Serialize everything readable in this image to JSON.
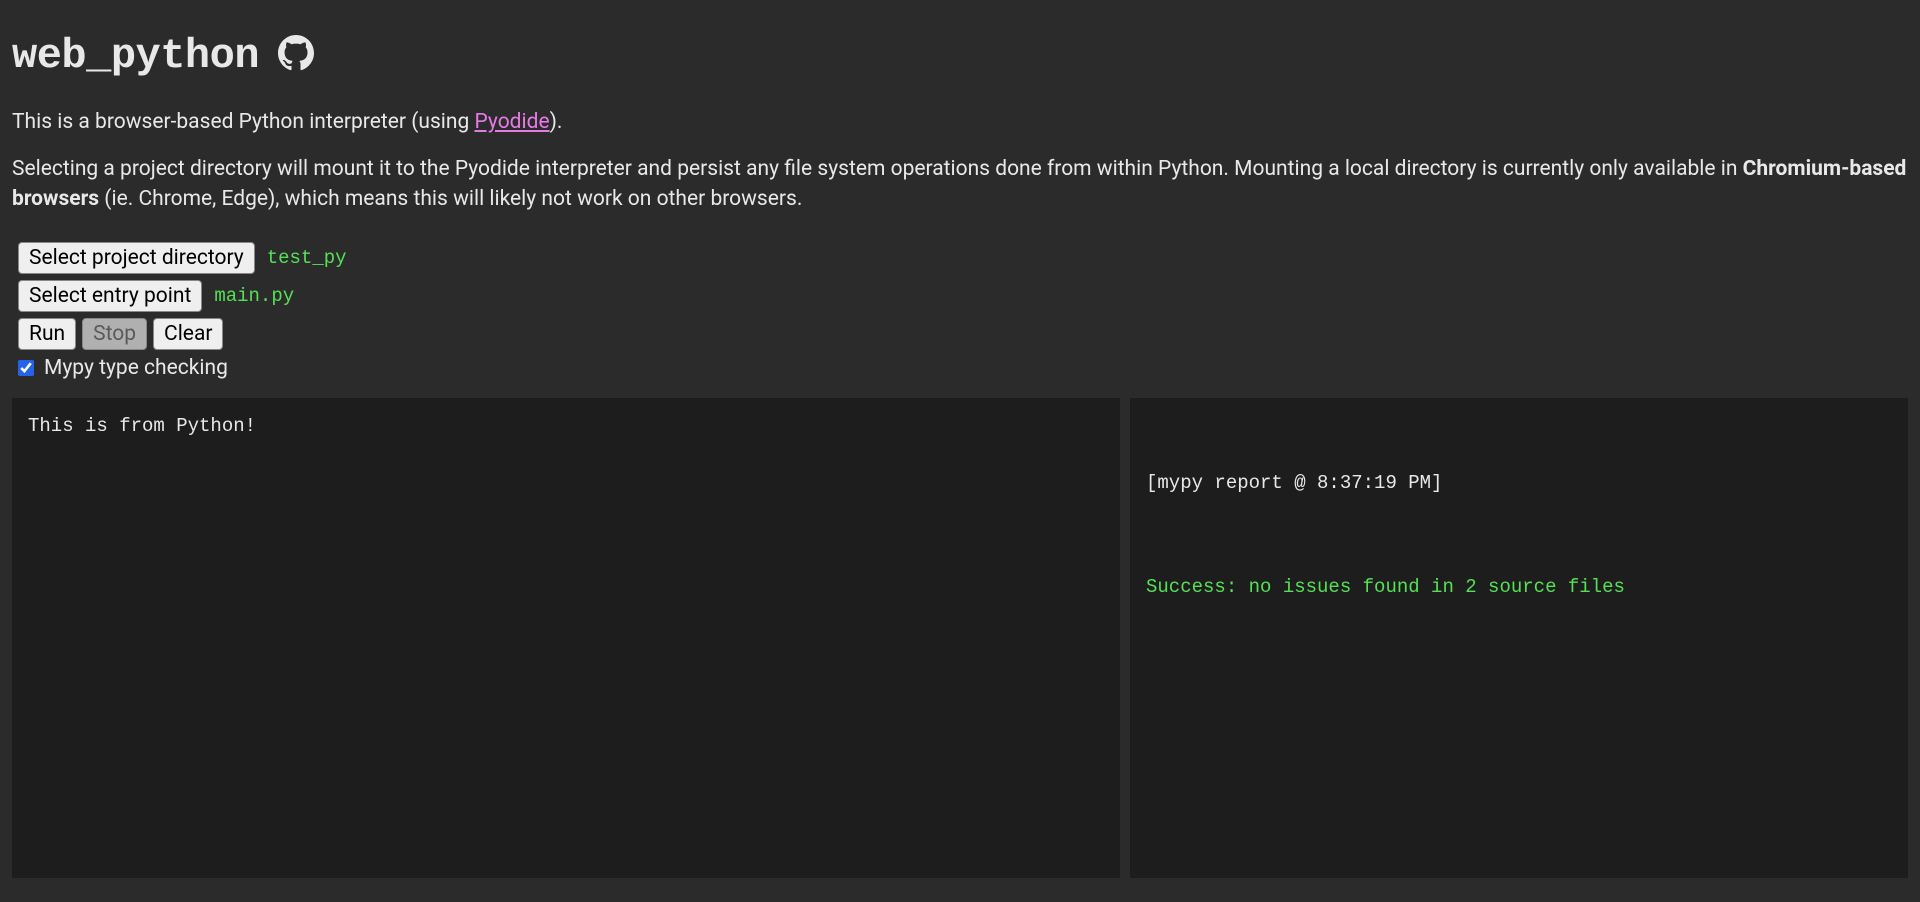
{
  "header": {
    "title": "web_python"
  },
  "intro": {
    "line1_prefix": "This is a browser-based Python interpreter (using ",
    "pyodide_link": "Pyodide",
    "line1_suffix": ").",
    "line2_prefix": "Selecting a project directory will mount it to the Pyodide interpreter and persist any file system operations done from within Python. Mounting a local directory is currently only available in ",
    "line2_strong": "Chromium-based browsers",
    "line2_suffix": " (ie. Chrome, Edge), which means this will likely not work on other browsers."
  },
  "controls": {
    "select_directory_label": "Select project directory",
    "selected_directory": "test_py",
    "select_entry_label": "Select entry point",
    "selected_entry": "main.py",
    "run_label": "Run",
    "stop_label": "Stop",
    "clear_label": "Clear",
    "mypy_checkbox_label": "Mypy type checking",
    "mypy_checked": true
  },
  "output": {
    "stdout": "This is from Python!"
  },
  "mypy": {
    "header": "[mypy report @ 8:37:19 PM]",
    "result": "Success: no issues found in 2 source files"
  }
}
